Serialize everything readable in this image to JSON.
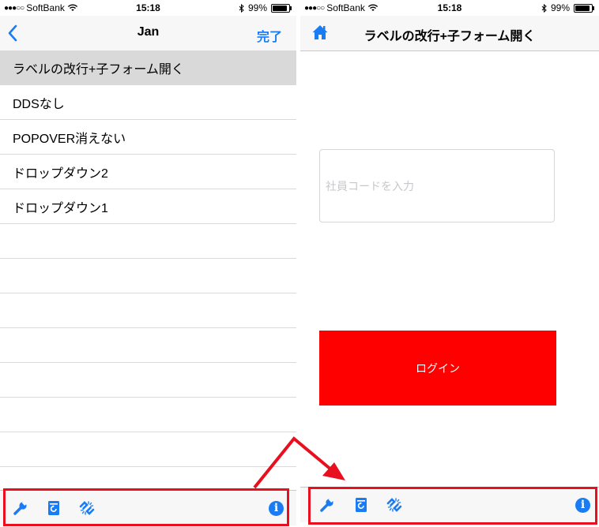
{
  "colors": {
    "accent": "#1a7cf5",
    "login_button": "#ff0000",
    "annotation": "#e8101e",
    "selected_row": "#d9d9d9"
  },
  "left_screen": {
    "status": {
      "signal": "●●●○○",
      "carrier": "SoftBank",
      "time": "15:18",
      "battery": "99%"
    },
    "navbar": {
      "back_icon": "chevron-left-icon",
      "title": "Jan",
      "done_label": "完了"
    },
    "list_items": [
      {
        "label": "ラベルの改行+子フォーム開く",
        "selected": true
      },
      {
        "label": "DDSなし"
      },
      {
        "label": "POPOVER消えない"
      },
      {
        "label": "ドロップダウン2"
      },
      {
        "label": "ドロップダウン1"
      }
    ],
    "toolbar": {
      "icons": [
        "wrench-icon",
        "refresh-document-icon",
        "broken-link-icon",
        "info-icon"
      ]
    }
  },
  "right_screen": {
    "status": {
      "signal": "●●●○○",
      "carrier": "SoftBank",
      "time": "15:18",
      "battery": "99%"
    },
    "navbar": {
      "home_icon": "home-icon",
      "title": "ラベルの改行+子フォーム開く"
    },
    "employee_input": {
      "value": "",
      "placeholder": "社員コードを入力"
    },
    "login_label": "ログイン",
    "toolbar": {
      "icons": [
        "wrench-icon",
        "refresh-document-icon",
        "broken-link-icon",
        "info-icon"
      ]
    }
  },
  "annotation": {
    "description_icon": "arrow-icon"
  }
}
